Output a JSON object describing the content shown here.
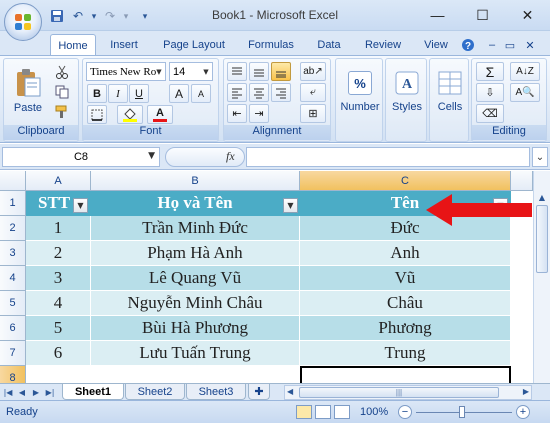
{
  "window": {
    "title": "Book1 - Microsoft Excel",
    "minimize_glyph": "—",
    "maximize_glyph": "☐",
    "close_glyph": "✕"
  },
  "qat": {
    "undo_glyph": "↶",
    "redo_glyph": "↷",
    "more_glyph": "▾"
  },
  "tabs": [
    "Home",
    "Insert",
    "Page Layout",
    "Formulas",
    "Data",
    "Review",
    "View"
  ],
  "ribbon": {
    "clipboard": {
      "label": "Clipboard",
      "paste": "Paste"
    },
    "font": {
      "label": "Font",
      "font_name": "Times New Ro",
      "font_size": "14",
      "bold": "B",
      "italic": "I",
      "underline": "U",
      "grow": "A",
      "shrink": "A",
      "fill_glyph": "A",
      "font_color_glyph": "A"
    },
    "alignment": {
      "label": "Alignment"
    },
    "number": {
      "label": "Number",
      "glyph": "%"
    },
    "styles": {
      "label": "Styles"
    },
    "cells": {
      "label": "Cells"
    },
    "editing": {
      "label": "Editing",
      "sum": "Σ",
      "sort": "A",
      "find": "A"
    }
  },
  "formula_bar": {
    "name_box": "C8",
    "fx": "fx",
    "value": ""
  },
  "sheet": {
    "columns": [
      "A",
      "B",
      "C"
    ],
    "rows": [
      "1",
      "2",
      "3",
      "4",
      "5",
      "6",
      "7",
      "8"
    ],
    "header": [
      "STT",
      "Họ và Tên",
      "Tên"
    ],
    "data": [
      [
        "1",
        "Trần Minh Đức",
        "Đức"
      ],
      [
        "2",
        "Phạm Hà Anh",
        "Anh"
      ],
      [
        "3",
        "Lê Quang Vũ",
        "Vũ"
      ],
      [
        "4",
        "Nguyễn Minh Châu",
        "Châu"
      ],
      [
        "5",
        "Bùi Hà Phương",
        "Phương"
      ],
      [
        "6",
        "Lưu Tuấn Trung",
        "Trung"
      ]
    ],
    "selected_cell": "C8",
    "header_color": "#4bacc6",
    "band_dark": "#b7dee8",
    "band_light": "#dbeef3",
    "arrow_color": "#e81416"
  },
  "sheet_tabs": [
    "Sheet1",
    "Sheet2",
    "Sheet3"
  ],
  "status": {
    "ready": "Ready",
    "zoom": "100%"
  }
}
